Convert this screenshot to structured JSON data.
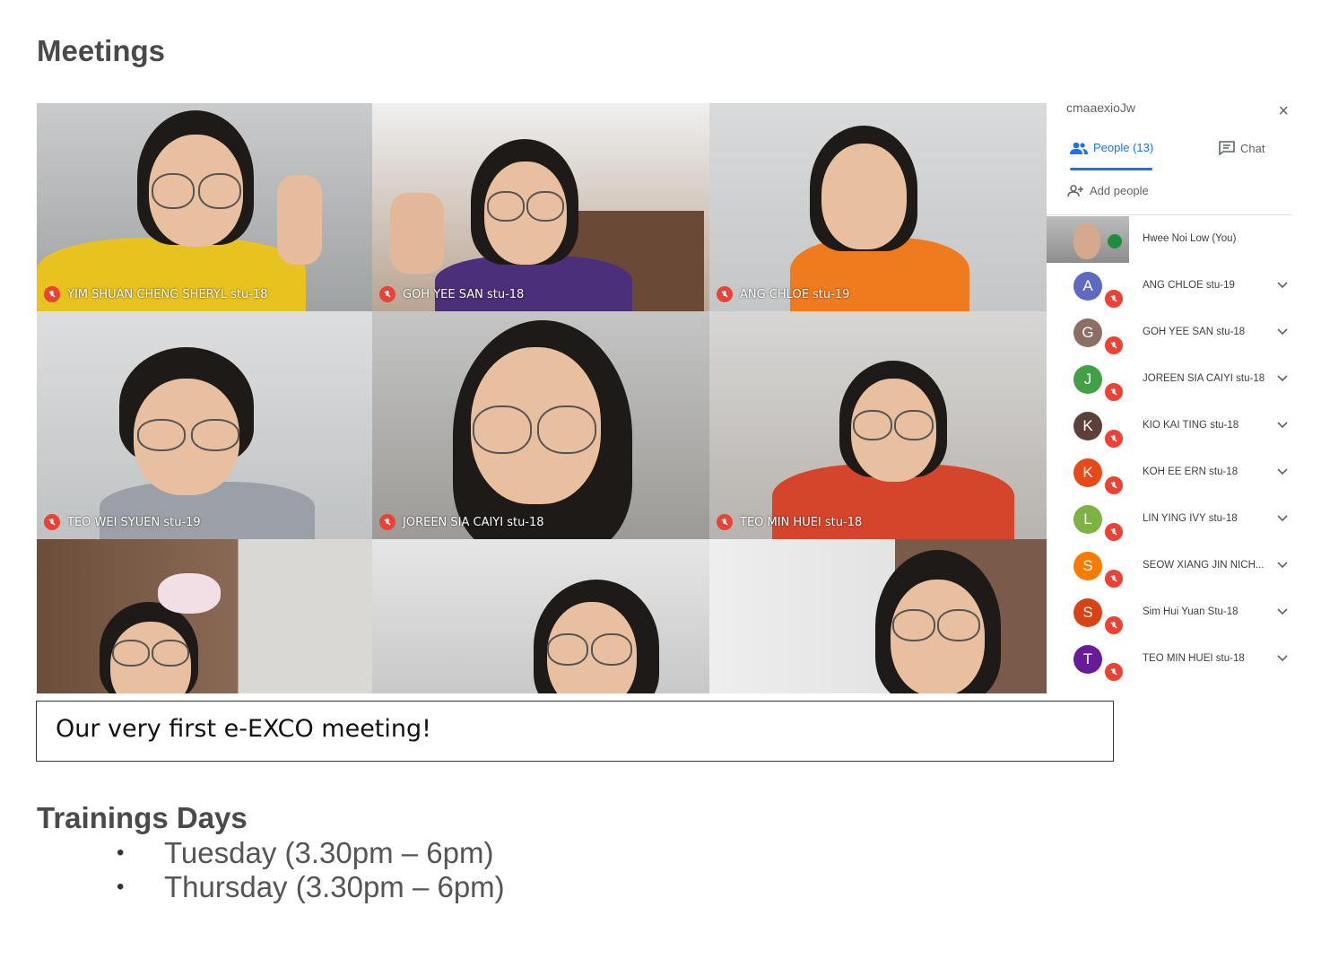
{
  "page": {
    "heading": "Meetings",
    "caption": "Our very first e-EXCO meeting!",
    "trainings_heading": "Trainings Days",
    "training_days": [
      "Tuesday (3.30pm – 6pm)",
      "Thursday (3.30pm – 6pm)"
    ]
  },
  "meet": {
    "meeting_code": "cmaaexioJw",
    "tabs": {
      "people": "People (13)",
      "chat": "Chat"
    },
    "add_people": "Add people",
    "self": "Hwee Noi Low (You)",
    "tiles": [
      "YIM SHUAN CHENG SHERYL stu-18",
      "GOH YEE SAN stu-18",
      "ANG CHLOE stu-19",
      "TEO WEI SYUEN stu-19",
      "JOREEN SIA CAIYI stu-18",
      "TEO MIN HUEI stu-18"
    ],
    "participants": [
      {
        "initial": "A",
        "name": "ANG CHLOE stu-19",
        "color": "#5c6bc0"
      },
      {
        "initial": "G",
        "name": "GOH YEE SAN stu-18",
        "color": "#8d6e63"
      },
      {
        "initial": "J",
        "name": "JOREEN SIA CAIYI stu-18",
        "color": "#43a047"
      },
      {
        "initial": "K",
        "name": "KIO KAI TING stu-18",
        "color": "#5d4037"
      },
      {
        "initial": "K",
        "name": "KOH EE ERN stu-18",
        "color": "#e64a19"
      },
      {
        "initial": "L",
        "name": "LIN YING IVY stu-18",
        "color": "#7cb342"
      },
      {
        "initial": "S",
        "name": "SEOW XIANG JIN NICH...",
        "color": "#f57c00"
      },
      {
        "initial": "S",
        "name": "Sim Hui Yuan Stu-18",
        "color": "#d84315"
      },
      {
        "initial": "T",
        "name": "TEO MIN HUEI stu-18",
        "color": "#6a1b9a"
      }
    ]
  }
}
